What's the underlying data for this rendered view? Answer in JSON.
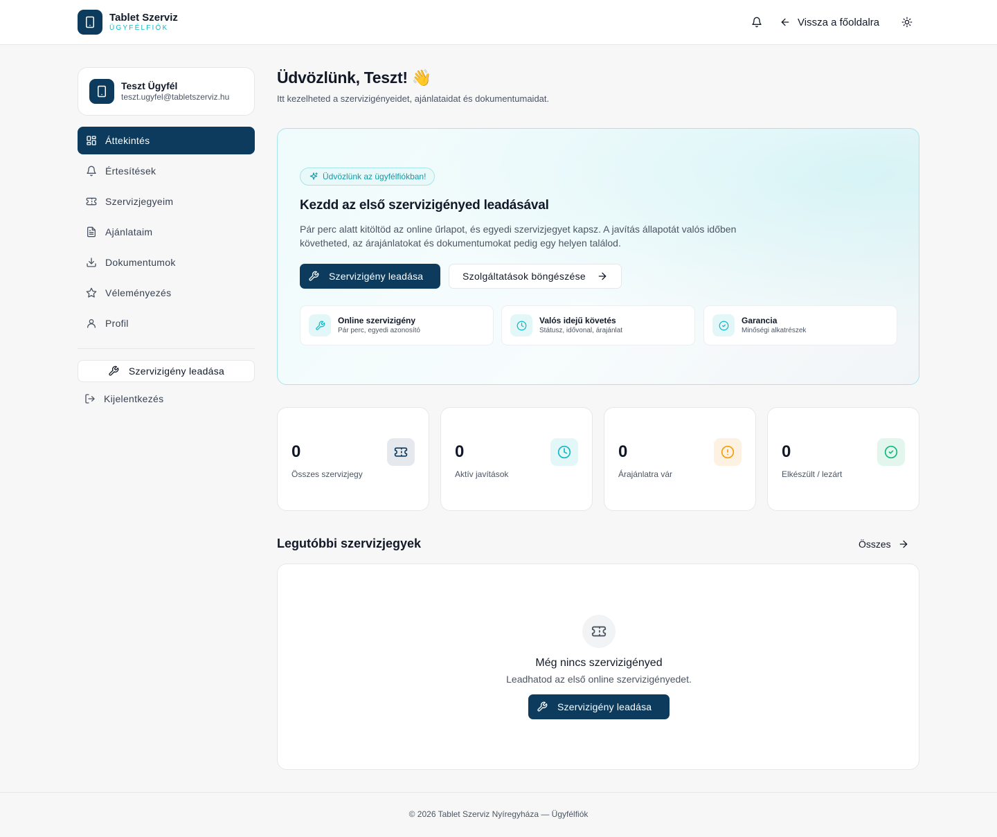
{
  "header": {
    "brand_name": "Tablet Szerviz",
    "brand_sub": "ÜGYFÉLFIÓK",
    "back_label": "Vissza a főoldalra",
    "icons": [
      "tablet-icon",
      "bell-icon",
      "arrow-left-icon",
      "sun-icon"
    ]
  },
  "user": {
    "name": "Teszt Ügyfél",
    "email": "teszt.ugyfel@tabletszerviz.hu"
  },
  "sidebar": {
    "items": [
      {
        "label": "Áttekintés",
        "icon": "grid-icon",
        "active": true
      },
      {
        "label": "Értesítések",
        "icon": "bell-icon"
      },
      {
        "label": "Szervizjegyeim",
        "icon": "ticket-icon"
      },
      {
        "label": "Ajánlataim",
        "icon": "document-icon"
      },
      {
        "label": "Dokumentumok",
        "icon": "download-icon"
      },
      {
        "label": "Véleményezés",
        "icon": "star-icon"
      },
      {
        "label": "Profil",
        "icon": "user-icon"
      }
    ],
    "cta_label": "Szervizigény leadása",
    "logout_label": "Kijelentkezés"
  },
  "welcome": {
    "title": "Üdvözlünk, Teszt!",
    "emoji": "👋",
    "subtitle": "Itt kezelheted a szervizigényeidet, ajánlataidat és dokumentumaidat."
  },
  "hero": {
    "badge": "Üdvözlünk az ügyfélfiókban!",
    "title": "Kezdd az első szervizigényed leadásával",
    "description": "Pár perc alatt kitöltöd az online űrlapot, és egyedi szervizjegyet kapsz. A javítás állapotát valós időben követheted, az árajánlatokat és dokumentumokat pedig egy helyen találod.",
    "primary_btn": "Szervizigény leadása",
    "secondary_btn": "Szolgáltatások böngészése",
    "features": [
      {
        "title": "Online szervizigény",
        "sub": "Pár perc, egyedi azonosító",
        "icon": "wrench-icon"
      },
      {
        "title": "Valós idejű követés",
        "sub": "Státusz, idővonal, árajánlat",
        "icon": "clock-icon"
      },
      {
        "title": "Garancia",
        "sub": "Minőségi alkatrészek",
        "icon": "check-circle-icon"
      }
    ]
  },
  "stats": [
    {
      "value": "0",
      "label": "Összes szervizjegy",
      "icon": "ticket-icon",
      "color": "#0c3b5e"
    },
    {
      "value": "0",
      "label": "Aktív javítások",
      "icon": "clock-icon",
      "color": "#14b8c4"
    },
    {
      "value": "0",
      "label": "Árajánlatra vár",
      "icon": "alert-circle-icon",
      "color": "#f59e0b"
    },
    {
      "value": "0",
      "label": "Elkészült / lezárt",
      "icon": "check-circle-icon",
      "color": "#10b981"
    }
  ],
  "recent": {
    "title": "Legutóbbi szervizjegyek",
    "link": "Összes",
    "empty_title": "Még nincs szervizigényed",
    "empty_sub": "Leadhatod az első online szervizigényedet.",
    "empty_btn": "Szervizigény leadása"
  },
  "footer": {
    "text": "© 2026 Tablet Szerviz Nyíregyháza — Ügyfélfiók"
  },
  "colors": {
    "primary": "#0c3b5e",
    "accent": "#14b8c4",
    "warning": "#f59e0b",
    "success": "#10b981"
  }
}
